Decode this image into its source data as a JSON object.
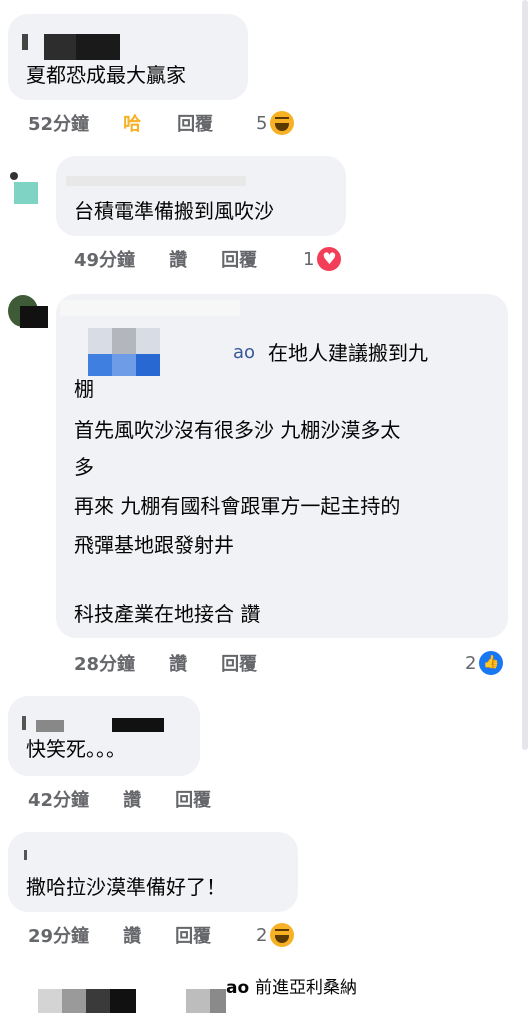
{
  "comments": [
    {
      "text": "夏都恐成最大贏家",
      "time": "52分鐘",
      "reaction_label": "哈",
      "reply": "回覆",
      "reaction_count": "5",
      "reaction_icon": "haha-icon"
    },
    {
      "text": "台積電準備搬到風吹沙",
      "time": "49分鐘",
      "reaction_label": "讚",
      "reply": "回覆",
      "reaction_count": "1",
      "reaction_icon": "love-icon"
    },
    {
      "mention_suffix": "ao",
      "lines": [
        "在地人建議搬到九",
        "棚",
        "首先風吹沙沒有很多沙 九棚沙漠多太",
        "多",
        "再來 九棚有國科會跟軍方一起主持的",
        "飛彈基地跟發射井",
        "",
        "科技產業在地接合 讚"
      ],
      "time": "28分鐘",
      "reaction_label": "讚",
      "reply": "回覆",
      "reaction_count": "2",
      "reaction_icon": "like-icon"
    },
    {
      "text": "快笑死。。。",
      "time": "42分鐘",
      "reaction_label": "讚",
      "reply": "回覆"
    },
    {
      "text": "撒哈拉沙漠準備好了！",
      "time": "29分鐘",
      "reaction_label": "讚",
      "reply": "回覆",
      "reaction_count": "2",
      "reaction_icon": "haha-icon"
    }
  ],
  "bottom_reply": {
    "mention_suffix": "ao",
    "text": "前進亞利桑納"
  },
  "colors": {
    "bubble": "#f0f2f5",
    "meta": "#65676b",
    "haha": "#f7b125",
    "active_label": "#f7b125"
  }
}
